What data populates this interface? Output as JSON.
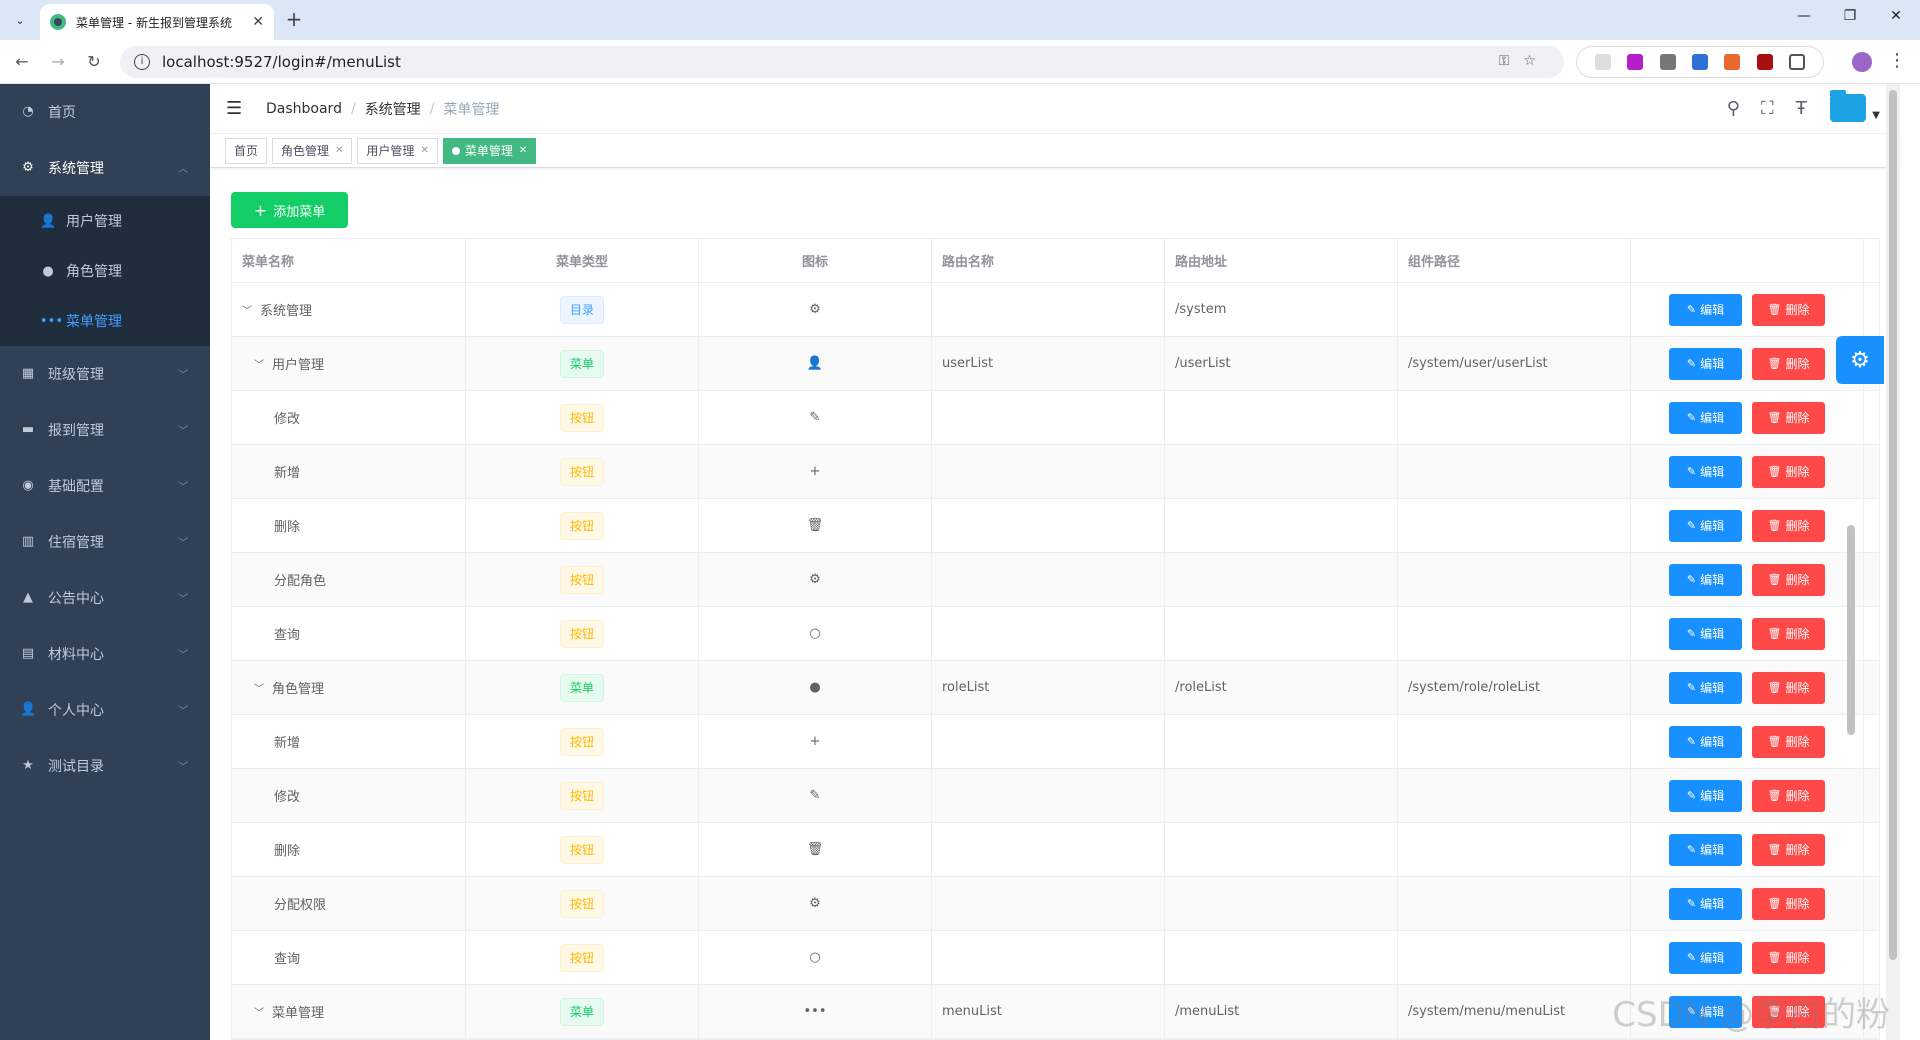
{
  "browser": {
    "tab_title": "菜单管理 - 新生报到管理系统",
    "url": "localhost:9527/login#/menuList"
  },
  "sidebar": {
    "items": [
      {
        "label": "首页",
        "icon": "dashboard-icon"
      },
      {
        "label": "系统管理",
        "icon": "gear-icon",
        "open": true
      },
      {
        "label": "班级管理",
        "icon": "grid-icon"
      },
      {
        "label": "报到管理",
        "icon": "monitor-icon"
      },
      {
        "label": "基础配置",
        "icon": "lifebuoy-icon"
      },
      {
        "label": "住宿管理",
        "icon": "building-icon"
      },
      {
        "label": "公告中心",
        "icon": "bell-icon"
      },
      {
        "label": "材料中心",
        "icon": "document-icon"
      },
      {
        "label": "个人中心",
        "icon": "user-icon"
      },
      {
        "label": "测试目录",
        "icon": "star-icon"
      }
    ],
    "sub": [
      {
        "label": "用户管理",
        "icon": "user-icon"
      },
      {
        "label": "角色管理",
        "icon": "pin-icon"
      },
      {
        "label": "菜单管理",
        "icon": "more-icon",
        "active": true
      }
    ]
  },
  "breadcrumb": [
    "Dashboard",
    "系统管理",
    "菜单管理"
  ],
  "tags": [
    "首页",
    "角色管理",
    "用户管理",
    "菜单管理"
  ],
  "toolbar": {
    "add_label": "添加菜单"
  },
  "table": {
    "headers": [
      "菜单名称",
      "菜单类型",
      "图标",
      "路由名称",
      "路由地址",
      "组件路径",
      ""
    ],
    "edit_label": "编辑",
    "delete_label": "删除",
    "rows": [
      {
        "name": "系统管理",
        "level": 0,
        "expand": true,
        "type": "目录",
        "type_kind": "dir",
        "icon": "gear-icon",
        "icon_char": "⚙",
        "route_name": "",
        "route_path": "/system",
        "component": ""
      },
      {
        "name": "用户管理",
        "level": 1,
        "expand": true,
        "type": "菜单",
        "type_kind": "menu",
        "icon": "user-icon",
        "icon_char": "👤",
        "route_name": "userList",
        "route_path": "/userList",
        "component": "/system/user/userList"
      },
      {
        "name": "修改",
        "level": 2,
        "type": "按钮",
        "type_kind": "btn",
        "icon": "edit-icon",
        "icon_char": "✎",
        "route_name": "",
        "route_path": "",
        "component": ""
      },
      {
        "name": "新增",
        "level": 2,
        "type": "按钮",
        "type_kind": "btn",
        "icon": "plus-icon",
        "icon_char": "+",
        "route_name": "",
        "route_path": "",
        "component": ""
      },
      {
        "name": "删除",
        "level": 2,
        "type": "按钮",
        "type_kind": "btn",
        "icon": "trash-icon",
        "icon_char": "🗑",
        "route_name": "",
        "route_path": "",
        "component": ""
      },
      {
        "name": "分配角色",
        "level": 2,
        "type": "按钮",
        "type_kind": "btn",
        "icon": "gear-icon",
        "icon_char": "⚙",
        "route_name": "",
        "route_path": "",
        "component": ""
      },
      {
        "name": "查询",
        "level": 2,
        "type": "按钮",
        "type_kind": "btn",
        "icon": "search-icon",
        "icon_char": "○",
        "route_name": "",
        "route_path": "",
        "component": ""
      },
      {
        "name": "角色管理",
        "level": 1,
        "expand": true,
        "type": "菜单",
        "type_kind": "menu",
        "icon": "pin-icon",
        "icon_char": "●",
        "route_name": "roleList",
        "route_path": "/roleList",
        "component": "/system/role/roleList"
      },
      {
        "name": "新增",
        "level": 2,
        "type": "按钮",
        "type_kind": "btn",
        "icon": "plus-icon",
        "icon_char": "+",
        "route_name": "",
        "route_path": "",
        "component": ""
      },
      {
        "name": "修改",
        "level": 2,
        "type": "按钮",
        "type_kind": "btn",
        "icon": "edit-icon",
        "icon_char": "✎",
        "route_name": "",
        "route_path": "",
        "component": ""
      },
      {
        "name": "删除",
        "level": 2,
        "type": "按钮",
        "type_kind": "btn",
        "icon": "trash-icon",
        "icon_char": "🗑",
        "route_name": "",
        "route_path": "",
        "component": ""
      },
      {
        "name": "分配权限",
        "level": 2,
        "type": "按钮",
        "type_kind": "btn",
        "icon": "gear-icon",
        "icon_char": "⚙",
        "route_name": "",
        "route_path": "",
        "component": ""
      },
      {
        "name": "查询",
        "level": 2,
        "type": "按钮",
        "type_kind": "btn",
        "icon": "search-icon",
        "icon_char": "○",
        "route_name": "",
        "route_path": "",
        "component": ""
      },
      {
        "name": "菜单管理",
        "level": 1,
        "expand": true,
        "type": "菜单",
        "type_kind": "menu",
        "icon": "more-icon",
        "icon_char": "•••",
        "route_name": "menuList",
        "route_path": "/menuList",
        "component": "/system/menu/menuList"
      }
    ]
  },
  "watermark": "CSDN @李白的粉",
  "colors": {
    "sidebar_bg": "#304156",
    "active_tag": "#42b983",
    "primary": "#1890ff",
    "danger": "#ff4949",
    "success": "#13ce66"
  }
}
